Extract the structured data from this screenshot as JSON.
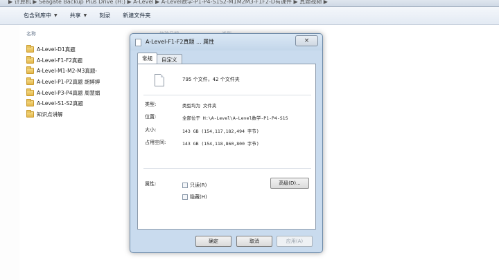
{
  "address_bar": {
    "crumbs": "▶ 计算机 ▶ Seagate Backup Plus Drive (H:) ▶ A-Level ▶ A-Level数学-P1-P4-S1S2-M1M2M3-F1F2-D有课件 ▶ 真题视频 ▶"
  },
  "toolbar": {
    "items": [
      "包含到库中 ▾",
      "共享 ▾",
      "刻录",
      "新建文件夹"
    ],
    "include_label": "包含到库中",
    "share_label": "共享",
    "burn_label": "刻录",
    "new_folder_label": "新建文件夹"
  },
  "explorer": {
    "column_header": "名称",
    "column_header_2": "修改日期",
    "column_header_3": "类型",
    "files": [
      "A-Level-D1真题",
      "A-Level-F1-F2真题",
      "A-Level-M1-M2-M3真题-",
      "A-Level-P1-P2真题 胡婷婷",
      "A-Level-P3-P4真题 周慧娟",
      "A-Level-S1-S2真题",
      "知识点讲解"
    ]
  },
  "dialog": {
    "title": "A-Level-F1-F2真题 ... 属性",
    "close_glyph": "×",
    "tabs": [
      "常规",
      "自定义"
    ],
    "summary": "795 个文件，42 个文件夹",
    "type_label": "类型:",
    "type_value": "类型均为 文件夹",
    "location_label": "位置:",
    "location_value": "全部位于 H:\\A-Level\\A-Level数学-P1-P4-S1S",
    "size_label": "大小:",
    "size_value": "143 GB (154,117,182,494 字节)",
    "disk_size_label": "占用空间:",
    "disk_size_value": "143 GB (154,118,860,800 字节)",
    "attributes_label": "属性:",
    "readonly_label": "只读(R)",
    "hidden_label": "隐藏(H)",
    "advanced_label": "高级(D)...",
    "ok_label": "确定",
    "cancel_label": "取消",
    "apply_label": "应用(A)"
  },
  "colors": {
    "dialog_frame": "#c9dbee",
    "toolbar_bg": "#e3eaf3",
    "folder": "#e2b64a"
  }
}
